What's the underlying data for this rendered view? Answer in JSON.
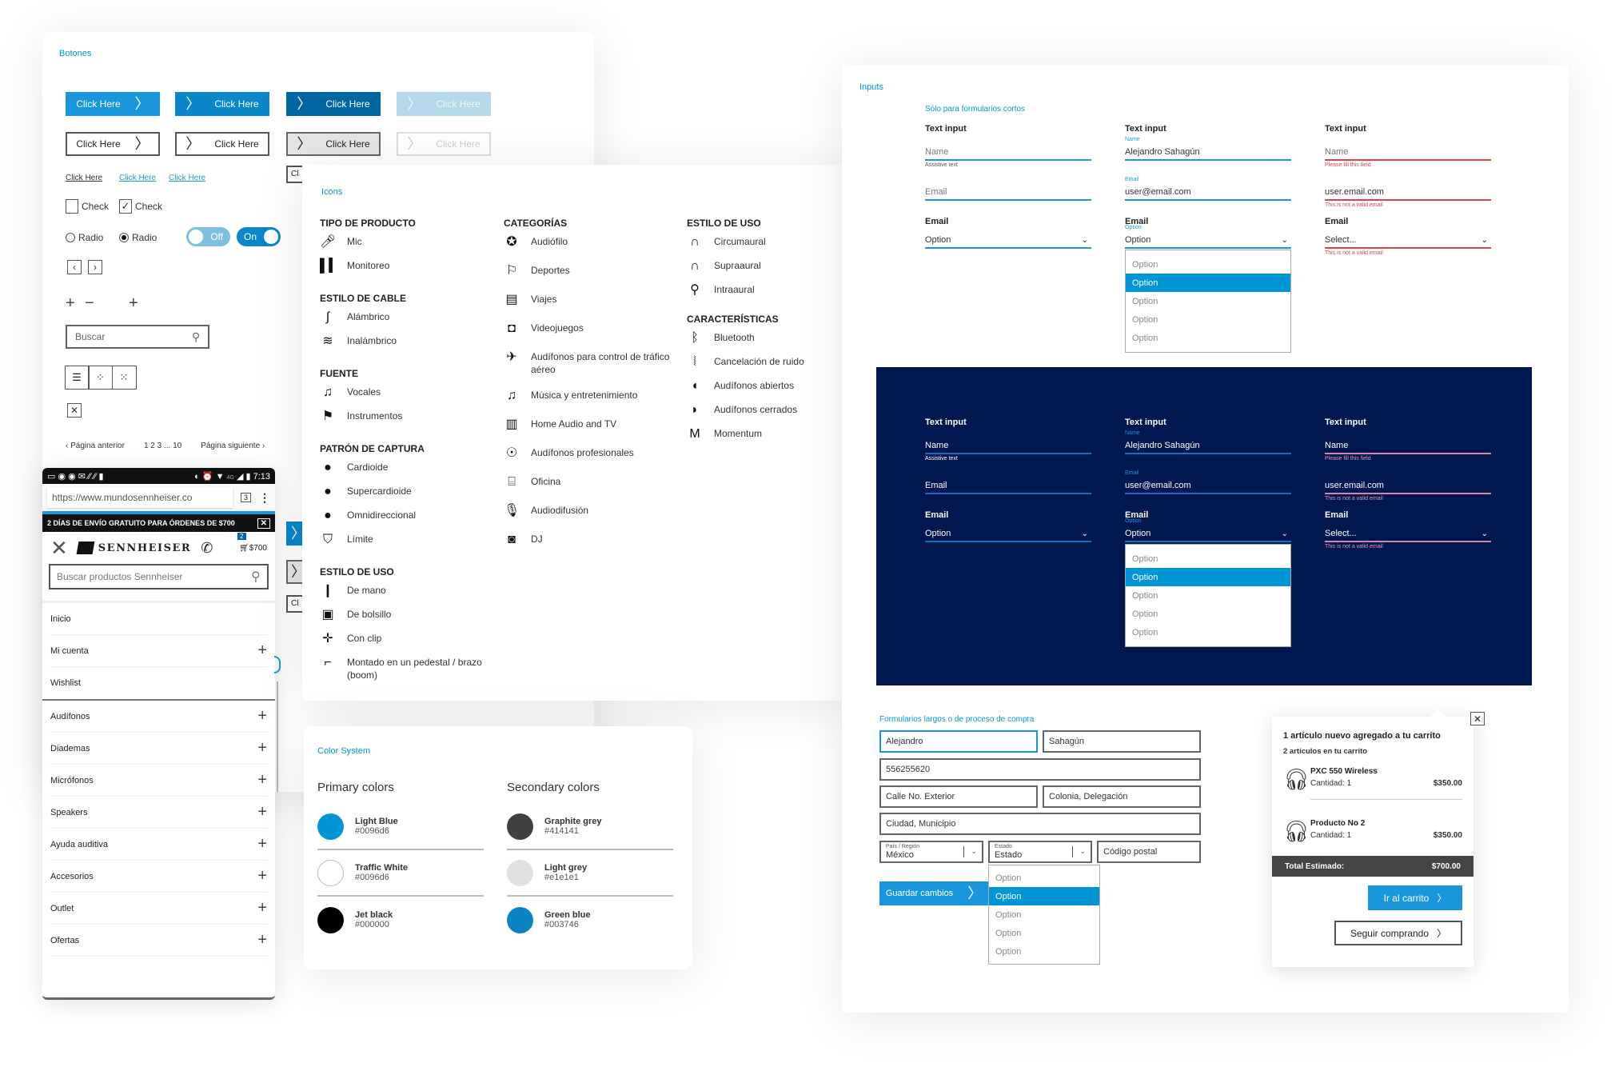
{
  "botones": {
    "title": "Botones",
    "row1": [
      "Click Here",
      "Click Here",
      "Click Here",
      "Click Here"
    ],
    "row2": [
      "Click Here",
      "Click Here",
      "Click Here",
      "Click Here"
    ],
    "links": [
      "Click Here",
      "Click Here",
      "Click Here"
    ],
    "checks": [
      {
        "label": "Check",
        "checked": false
      },
      {
        "label": "Check",
        "checked": true
      }
    ],
    "radios": [
      {
        "label": "Radio",
        "selected": false
      },
      {
        "label": "Radio",
        "selected": true
      }
    ],
    "toggles": [
      {
        "label": "Off",
        "state": "off"
      },
      {
        "label": "On",
        "state": "on"
      }
    ],
    "search_placeholder": "Buscar",
    "pagination": {
      "prev": "Página anterior",
      "pages": "1 2 3 ... 10",
      "next": "Página siguiente"
    },
    "partial_labels": [
      "Cl",
      "Cl"
    ]
  },
  "icons": {
    "title": "Icons",
    "columns": [
      [
        {
          "heading": "TIPO DE PRODUCTO",
          "items": [
            {
              "icon": "mic-icon",
              "label": "Mic"
            },
            {
              "icon": "monitor-bars-icon",
              "label": "Monitoreo"
            }
          ]
        },
        {
          "heading": "ESTILO DE CABLE",
          "items": [
            {
              "icon": "cable-icon",
              "label": "Alámbrico"
            },
            {
              "icon": "wifi-icon",
              "label": "Inalámbrico"
            }
          ]
        },
        {
          "heading": "FUENTE",
          "items": [
            {
              "icon": "vocals-icon",
              "label": "Vocales"
            },
            {
              "icon": "guitar-icon",
              "label": "Instrumentos"
            }
          ]
        },
        {
          "heading": "PATRÓN DE CAPTURA",
          "items": [
            {
              "icon": "cardioid-icon",
              "label": "Cardioide"
            },
            {
              "icon": "supercardioid-icon",
              "label": "Supercardioide"
            },
            {
              "icon": "omni-icon",
              "label": "Omnidireccional"
            },
            {
              "icon": "boundary-icon",
              "label": "Límite"
            }
          ]
        },
        {
          "heading": "ESTILO DE USO",
          "items": [
            {
              "icon": "handheld-mic-icon",
              "label": "De mano"
            },
            {
              "icon": "bodypack-icon",
              "label": "De bolsillo"
            },
            {
              "icon": "clip-icon",
              "label": "Con clip"
            },
            {
              "icon": "boom-stand-icon",
              "label": "Montado en un pedestal / brazo (boom)"
            }
          ]
        }
      ],
      [
        {
          "heading": "CATEGORÍAS",
          "items": [
            {
              "icon": "award-icon",
              "label": "Audiófilo"
            },
            {
              "icon": "running-icon",
              "label": "Deportes"
            },
            {
              "icon": "travel-icon",
              "label": "Viajes"
            },
            {
              "icon": "gamepad-icon",
              "label": "Videojuegos"
            },
            {
              "icon": "airplane-icon",
              "label": "Audífonos para control de tráfico aéreo"
            },
            {
              "icon": "music-note-icon",
              "label": "Música y entretenimiento"
            },
            {
              "icon": "home-audio-icon",
              "label": "Home Audio and TV"
            },
            {
              "icon": "pro-headphones-icon",
              "label": "Audífonos profesionales"
            },
            {
              "icon": "office-icon",
              "label": "Oficina"
            },
            {
              "icon": "broadcast-mic-icon",
              "label": "Audiodifusión"
            },
            {
              "icon": "turntable-icon",
              "label": "DJ"
            }
          ]
        }
      ],
      [
        {
          "heading": "ESTILO DE USO",
          "items": [
            {
              "icon": "circumaural-icon",
              "label": "Circumaural"
            },
            {
              "icon": "supraaural-icon",
              "label": "Supraaural"
            },
            {
              "icon": "earbuds-icon",
              "label": "Intraaural"
            }
          ]
        },
        {
          "heading": "CARACTERÍSTICAS",
          "items": [
            {
              "icon": "bluetooth-icon",
              "label": "Bluetooth"
            },
            {
              "icon": "noise-cancel-icon",
              "label": "Cancelación de ruido"
            },
            {
              "icon": "open-back-icon",
              "label": "Audífonos abiertos"
            },
            {
              "icon": "closed-back-icon",
              "label": "Audífonos cerrados"
            },
            {
              "icon": "momentum-icon",
              "label": "Momentum"
            }
          ]
        }
      ]
    ]
  },
  "colors": {
    "title": "Color System",
    "primary": {
      "heading": "Primary colors",
      "items": [
        {
          "name": "Light Blue",
          "hex": "#0096d6",
          "swatch": "#0096d6"
        },
        {
          "name": "Traffic White",
          "hex": "#0096d6",
          "swatch": "#ffffff"
        },
        {
          "name": "Jet black",
          "hex": "#000000",
          "swatch": "#000000"
        }
      ]
    },
    "secondary": {
      "heading": "Secondary colors",
      "items": [
        {
          "name": "Graphite grey",
          "hex": "#414141",
          "swatch": "#414141"
        },
        {
          "name": "Light grey",
          "hex": "#e1e1e1",
          "swatch": "#e1e1e1"
        },
        {
          "name": "Green blue",
          "hex": "#003746",
          "swatch": "#0a84c4"
        }
      ]
    }
  },
  "phone": {
    "status": {
      "time": "7:13",
      "network": "4G"
    },
    "url": "https://www.mundosennheiser.co",
    "tab_count": "3",
    "promo": "2 DÍAS DE ENVÍO GRATUITO PARA ÓRDENES DE $700",
    "brand": "SENNHEISER",
    "cart_count": "2",
    "cart_total": "$700",
    "search_placeholder": "Buscar productos Sennheiser",
    "menu_top": [
      {
        "label": "Inicio",
        "expandable": false
      },
      {
        "label": "Mi cuenta",
        "expandable": true
      },
      {
        "label": "Wishlist",
        "expandable": false
      }
    ],
    "menu_categories": [
      "Audífonos",
      "Diademas",
      "Micrófonos",
      "Speakers",
      "Ayuda auditiva",
      "Accesorios",
      "Outlet",
      "Ofertas"
    ]
  },
  "inputs": {
    "title": "Inputs",
    "short_forms_title": "Sólo para formularios cortos",
    "columns": [
      {
        "state": "default",
        "text_label": "Text input",
        "name": {
          "float": "",
          "value": "Name",
          "placeholder": true,
          "help": "Assistive text",
          "error": false
        },
        "email": {
          "float": "",
          "value": "Email",
          "placeholder": true,
          "help": "",
          "error": false
        },
        "select_label": "Email",
        "select": {
          "float": "",
          "value": "Option",
          "help": "",
          "error": false
        }
      },
      {
        "state": "filled",
        "text_label": "Text input",
        "name": {
          "float": "Name",
          "value": "Alejandro Sahagún",
          "placeholder": false,
          "help": "",
          "error": false
        },
        "email": {
          "float": "Email",
          "value": "user@email.com",
          "placeholder": false,
          "help": "",
          "error": false
        },
        "select_label": "Email",
        "select": {
          "float": "Option",
          "value": "Option",
          "help": "",
          "error": false
        }
      },
      {
        "state": "error",
        "text_label": "Text input",
        "name": {
          "float": "",
          "value": "Name",
          "placeholder": true,
          "help": "Please fill this field",
          "error": true
        },
        "email": {
          "float": "",
          "value": "user.email.com",
          "placeholder": false,
          "help": "This is not a valid email",
          "error": true
        },
        "select_label": "Email",
        "select": {
          "float": "",
          "value": "Select...",
          "help": "This is not a valid email",
          "error": true
        }
      }
    ],
    "dropdown_options": [
      "Option",
      "Option",
      "Option",
      "Option",
      "Option"
    ],
    "dropdown_selected_index": 1,
    "long_forms_title": "Formularios largos o de proceso de compra",
    "long_form": {
      "first_name": "Alejandro",
      "last_name": "Sahagún",
      "phone": "556255620",
      "street": "Calle No. Exterior",
      "colonia": "Colonia, Delegación",
      "city": "Ciudad, Municipio",
      "country_label": "País / Región",
      "country_value": "México",
      "state_label": "Estado",
      "state_value": "Estado",
      "zip": "Código postal",
      "save_button": "Guardar cambios"
    }
  },
  "cart": {
    "headline": "1 artículo nuevo agregado a tu carrito",
    "subline": "2 artículos en tu carrito",
    "items": [
      {
        "name": "PXC 550 Wireless",
        "qty": "Cantidad: 1",
        "price": "$350.00"
      },
      {
        "name": "Producto No 2",
        "qty": "Cantidad: 1",
        "price": "$350.00"
      }
    ],
    "total_label": "Total Estimado:",
    "total_value": "$700.00",
    "go_cart": "Ir al carrito",
    "keep_shopping": "Seguir comprando"
  }
}
